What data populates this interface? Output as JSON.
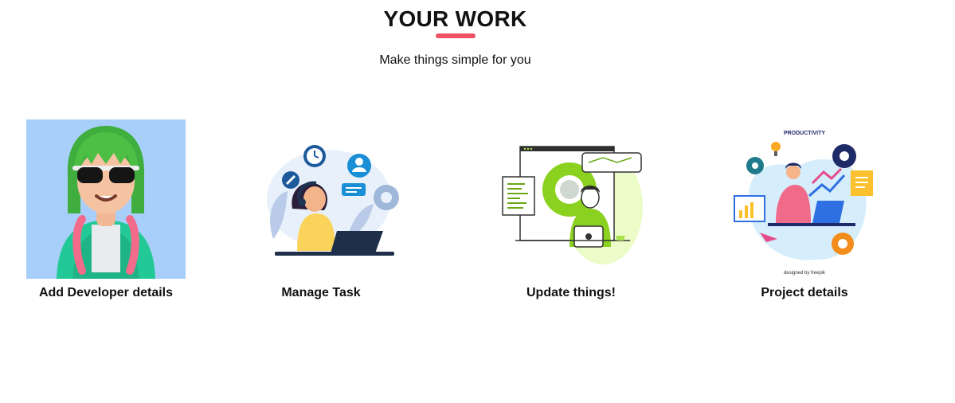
{
  "header": {
    "title": "YOUR WORK",
    "subtitle": "Make things simple for you",
    "accent_color": "#f05264"
  },
  "cards": [
    {
      "label": "Add Developer details",
      "image": "developer-avatar-illustration",
      "bg": "#a8cffa"
    },
    {
      "label": "Manage Task",
      "image": "support-agent-illustration"
    },
    {
      "label": "Update things!",
      "image": "developer-coding-illustration"
    },
    {
      "label": "Project details",
      "image": "productivity-illustration",
      "badge": "PRODUCTIVITY",
      "credit": "designed by freepik"
    }
  ]
}
